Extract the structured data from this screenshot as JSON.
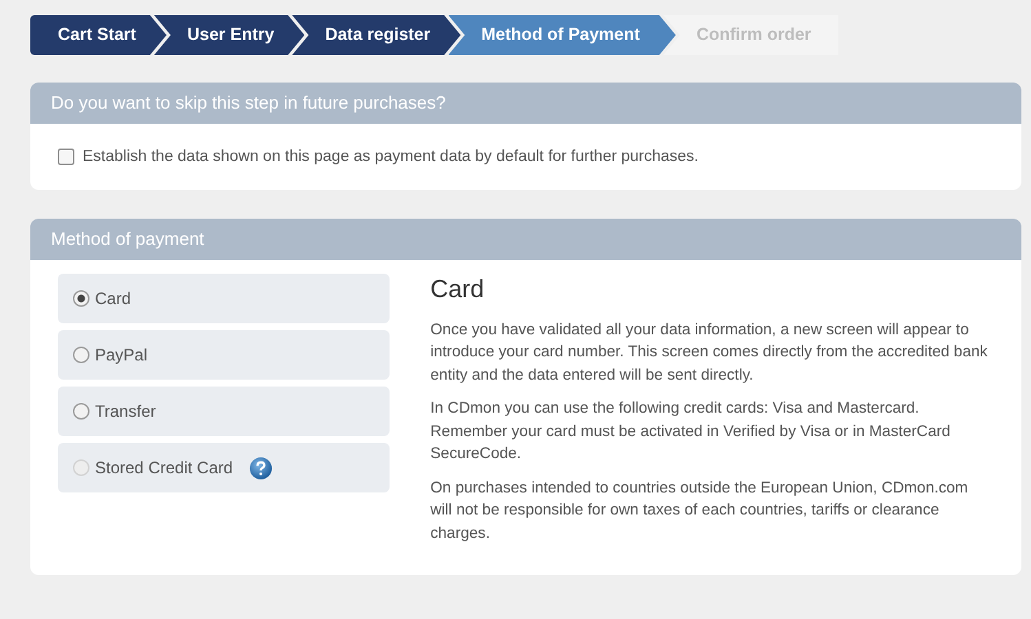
{
  "steps": [
    {
      "label": "Cart Start",
      "completed": true,
      "selected": false
    },
    {
      "label": "User Entry",
      "completed": true,
      "selected": false
    },
    {
      "label": "Data register",
      "completed": true,
      "selected": false
    },
    {
      "label": "Method of Payment",
      "completed": false,
      "selected": true
    },
    {
      "label": "Confirm order",
      "completed": false,
      "selected": false
    }
  ],
  "skip_panel": {
    "title": "Do you want to skip this step in future purchases?",
    "checkbox": {
      "label": "Establish the data shown on this page as payment data by default for further purchases.",
      "checked": false
    }
  },
  "payment_panel": {
    "title": "Method of payment",
    "options": [
      {
        "label": "Card",
        "selected": true,
        "disabled": false,
        "help": false
      },
      {
        "label": "PayPal",
        "selected": false,
        "disabled": false,
        "help": false
      },
      {
        "label": "Transfer",
        "selected": false,
        "disabled": false,
        "help": false
      },
      {
        "label": "Stored Credit Card",
        "selected": false,
        "disabled": true,
        "help": true
      }
    ],
    "detail": {
      "heading": "Card",
      "paragraphs": [
        "Once you have validated all your data information, a new screen will appear to introduce your card number. This screen comes directly from the accredited bank entity and the data entered will be sent directly.",
        "In CDmon you can use the following credit cards: Visa and Mastercard. Remember your card must be activated in Verified by Visa or in MasterCard SecureCode.",
        "On purchases intended to countries outside the European Union, CDmon.com will not be responsible for own taxes of each countries, tariffs or clearance charges."
      ]
    }
  }
}
